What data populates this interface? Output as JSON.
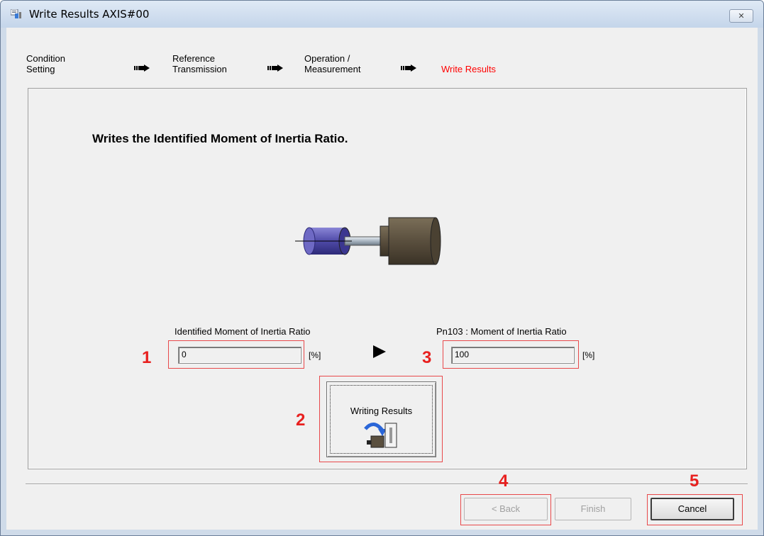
{
  "window": {
    "title": "Write Results AXIS#00",
    "close_label": "✕"
  },
  "steps": [
    {
      "line1": "Condition",
      "line2": "Setting",
      "active": false
    },
    {
      "line1": "Reference",
      "line2": "Transmission",
      "active": false
    },
    {
      "line1": "Operation /",
      "line2": "Measurement",
      "active": false
    },
    {
      "line1": "Write Results",
      "line2": "",
      "active": true
    }
  ],
  "main": {
    "heading": "Writes the Identified Moment of Inertia Ratio.",
    "identified": {
      "label": "Identified Moment of Inertia Ratio",
      "value": "0",
      "unit": "[%]"
    },
    "parameter": {
      "label": "Pn103   : Moment of Inertia Ratio",
      "value": "100",
      "unit": "[%]"
    },
    "write_button_label": "Writing Results"
  },
  "callouts": [
    "1",
    "2",
    "3",
    "4",
    "5"
  ],
  "footer": {
    "back_label": "< Back",
    "finish_label": "Finish",
    "cancel_label": "Cancel"
  },
  "colors": {
    "active_step": "#ff0000",
    "callout": "#e8201f",
    "callout_box": "#e8494b"
  }
}
